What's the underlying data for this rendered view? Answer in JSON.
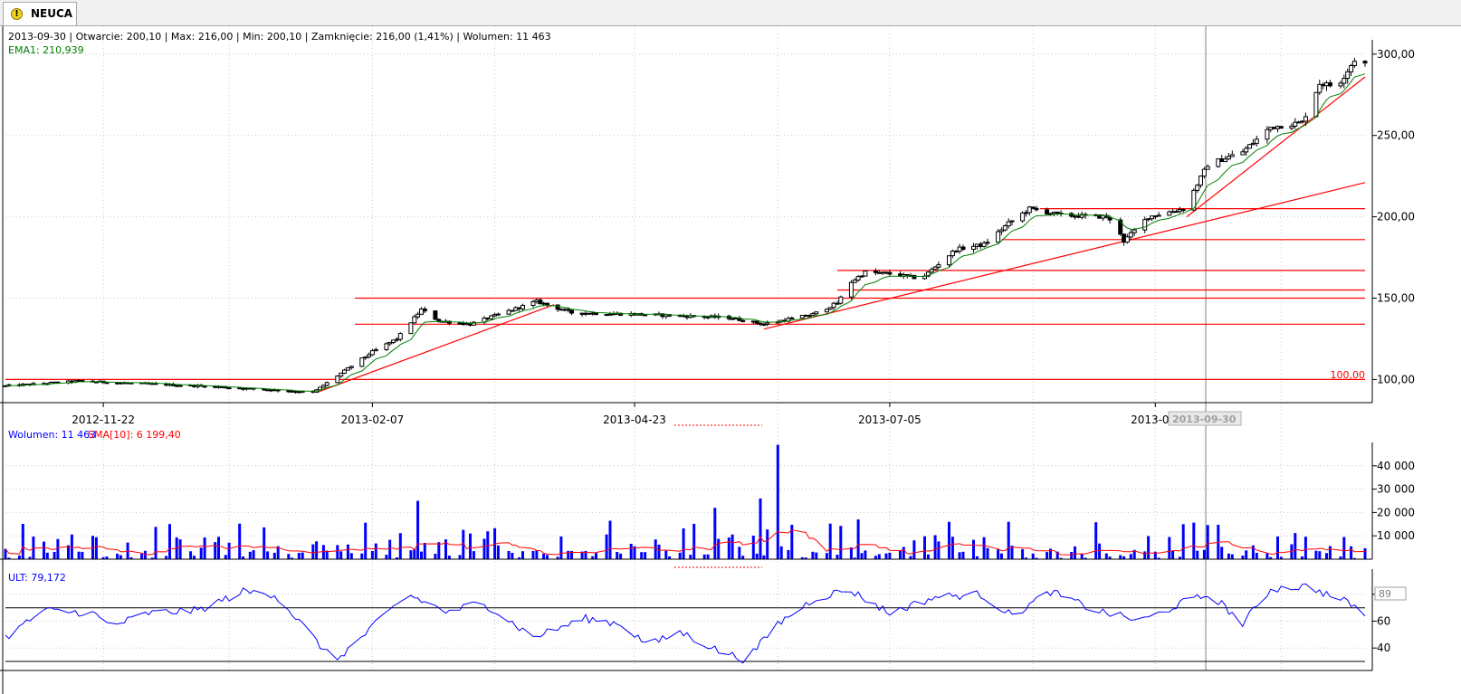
{
  "tab": {
    "label": "NEUCA",
    "icon": "warning-icon"
  },
  "colors": {
    "candle": "#000000",
    "ema": "#008000",
    "trend": "#ff0000",
    "volume": "#0000ff",
    "sma": "#ff0000",
    "ult": "#0000ff",
    "grid": "#c8c8c8"
  },
  "price_info": {
    "date": "2013-09-30",
    "open_label": "Otwarcie:",
    "open": "200,10",
    "max_label": "Max:",
    "max": "216,00",
    "min_label": "Min:",
    "min": "200,10",
    "close_label": "Zamknięcie:",
    "close": "216,00 (1,41%)",
    "volume_label": "Wolumen:",
    "volume": "11 463"
  },
  "ema_label": "EMA1: 210,939",
  "level_label": "100,00",
  "volume_panel": {
    "vol_label": "Wolumen: 11 463",
    "sma_label": "SMA[10]: 6 199,40"
  },
  "ult_panel": {
    "label": "ULT: 79,172",
    "current_value": "89"
  },
  "cursor_date_label": "2013-09-30",
  "chart_data": {
    "type": "candlestick",
    "x_tick_labels": [
      "2012-11-22",
      "2013-02-07",
      "2013-04-23",
      "2013-07-05",
      "2013-09-"
    ],
    "x_tick_dates": [
      "2012-11-22",
      "2013-02-07",
      "2013-04-23",
      "2013-07-05",
      "2013-09-19"
    ],
    "x_range": [
      "2012-10-25",
      "2013-11-18"
    ],
    "price_axis": {
      "ylim": [
        88,
        306
      ],
      "ticks": [
        "100,00",
        "150,00",
        "200,00",
        "250,00",
        "300,00"
      ],
      "tick_values": [
        100,
        150,
        200,
        250,
        300
      ]
    },
    "price_path": [
      {
        "date": "2012-10-25",
        "value": 96
      },
      {
        "date": "2012-11-15",
        "value": 99
      },
      {
        "date": "2012-12-20",
        "value": 96
      },
      {
        "date": "2013-01-14",
        "value": 93
      },
      {
        "date": "2013-01-21",
        "value": 92
      },
      {
        "date": "2013-02-07",
        "value": 117
      },
      {
        "date": "2013-02-14",
        "value": 125
      },
      {
        "date": "2013-02-21",
        "value": 143
      },
      {
        "date": "2013-02-26",
        "value": 136
      },
      {
        "date": "2013-03-07",
        "value": 134
      },
      {
        "date": "2013-03-26",
        "value": 148
      },
      {
        "date": "2013-04-05",
        "value": 141
      },
      {
        "date": "2013-04-25",
        "value": 140
      },
      {
        "date": "2013-05-20",
        "value": 138
      },
      {
        "date": "2013-05-30",
        "value": 134
      },
      {
        "date": "2013-06-13",
        "value": 140
      },
      {
        "date": "2013-06-20",
        "value": 147
      },
      {
        "date": "2013-06-24",
        "value": 160
      },
      {
        "date": "2013-06-28",
        "value": 166
      },
      {
        "date": "2013-07-05",
        "value": 165
      },
      {
        "date": "2013-07-14",
        "value": 162
      },
      {
        "date": "2013-07-24",
        "value": 180
      },
      {
        "date": "2013-08-01",
        "value": 183
      },
      {
        "date": "2013-08-08",
        "value": 196
      },
      {
        "date": "2013-08-14",
        "value": 205
      },
      {
        "date": "2013-08-23",
        "value": 201
      },
      {
        "date": "2013-09-05",
        "value": 200
      },
      {
        "date": "2013-09-09",
        "value": 190
      },
      {
        "date": "2013-09-10",
        "value": 185
      },
      {
        "date": "2013-09-17",
        "value": 200
      },
      {
        "date": "2013-09-27",
        "value": 205
      },
      {
        "date": "2013-09-30",
        "value": 216
      },
      {
        "date": "2013-10-04",
        "value": 232
      },
      {
        "date": "2013-10-14",
        "value": 240
      },
      {
        "date": "2013-10-22",
        "value": 255
      },
      {
        "date": "2013-10-31",
        "value": 258
      },
      {
        "date": "2013-11-05",
        "value": 282
      },
      {
        "date": "2013-11-10",
        "value": 280
      },
      {
        "date": "2013-11-16",
        "value": 300
      },
      {
        "date": "2013-11-18",
        "value": 294
      }
    ],
    "horizontal_levels": [
      {
        "y": 100,
        "from": "2012-10-25",
        "to": "2013-11-18"
      },
      {
        "y": 150,
        "from": "2013-02-02",
        "to": "2013-11-18"
      },
      {
        "y": 134,
        "from": "2013-02-02",
        "to": "2013-11-18"
      },
      {
        "y": 167,
        "from": "2013-06-20",
        "to": "2013-11-18"
      },
      {
        "y": 155,
        "from": "2013-06-20",
        "to": "2013-11-18"
      },
      {
        "y": 186,
        "from": "2013-08-06",
        "to": "2013-11-18"
      },
      {
        "y": 205,
        "from": "2013-08-17",
        "to": "2013-11-18"
      }
    ],
    "trend_lines": [
      {
        "from": {
          "date": "2013-01-22",
          "value": 92
        },
        "to": {
          "date": "2013-03-31",
          "value": 146
        }
      },
      {
        "from": {
          "date": "2013-05-30",
          "value": 131
        },
        "to": {
          "date": "2013-11-18",
          "value": 221
        }
      },
      {
        "from": {
          "date": "2013-09-28",
          "value": 200
        },
        "to": {
          "date": "2013-11-18",
          "value": 286
        }
      }
    ],
    "volume": {
      "ylim": [
        0,
        50000
      ],
      "ticks": [
        "10 000",
        "20 000",
        "30 000",
        "40 000"
      ],
      "tick_values": [
        10000,
        20000,
        30000,
        40000
      ],
      "spikes": [
        {
          "date": "2012-11-19",
          "value": 10000
        },
        {
          "date": "2012-12-08",
          "value": 27000
        },
        {
          "date": "2013-01-27",
          "value": 21000
        },
        {
          "date": "2013-02-02",
          "value": 26500
        },
        {
          "date": "2013-02-20",
          "value": 25000
        },
        {
          "date": "2013-03-03",
          "value": 30000
        },
        {
          "date": "2013-04-13",
          "value": 16000
        },
        {
          "date": "2013-05-16",
          "value": 22000
        },
        {
          "date": "2013-05-29",
          "value": 26000
        },
        {
          "date": "2013-06-03",
          "value": 49000
        },
        {
          "date": "2013-06-26",
          "value": 17000
        },
        {
          "date": "2013-07-22",
          "value": 16000
        },
        {
          "date": "2013-08-08",
          "value": 16000
        },
        {
          "date": "2013-09-27",
          "value": 15000
        },
        {
          "date": "2013-11-16",
          "value": 24000
        }
      ]
    },
    "ult": {
      "ylim": [
        28,
        92
      ],
      "ticks": [
        "40",
        "60",
        "80"
      ],
      "tick_values": [
        40,
        60,
        80
      ],
      "levels": [
        70,
        30
      ],
      "points": [
        {
          "date": "2012-10-25",
          "value": 48
        },
        {
          "date": "2012-11-05",
          "value": 68
        },
        {
          "date": "2012-11-19",
          "value": 66
        },
        {
          "date": "2012-11-24",
          "value": 56
        },
        {
          "date": "2012-12-05",
          "value": 66
        },
        {
          "date": "2012-12-19",
          "value": 68
        },
        {
          "date": "2013-01-01",
          "value": 82
        },
        {
          "date": "2013-01-10",
          "value": 80
        },
        {
          "date": "2013-01-17",
          "value": 60
        },
        {
          "date": "2013-01-27",
          "value": 30
        },
        {
          "date": "2013-02-04",
          "value": 48
        },
        {
          "date": "2013-02-17",
          "value": 80
        },
        {
          "date": "2013-03-01",
          "value": 66
        },
        {
          "date": "2013-03-10",
          "value": 75
        },
        {
          "date": "2013-03-25",
          "value": 48
        },
        {
          "date": "2013-04-09",
          "value": 62
        },
        {
          "date": "2013-04-19",
          "value": 58
        },
        {
          "date": "2013-04-27",
          "value": 42
        },
        {
          "date": "2013-05-06",
          "value": 52
        },
        {
          "date": "2013-05-17",
          "value": 38
        },
        {
          "date": "2013-05-25",
          "value": 31
        },
        {
          "date": "2013-06-03",
          "value": 58
        },
        {
          "date": "2013-06-13",
          "value": 76
        },
        {
          "date": "2013-06-23",
          "value": 84
        },
        {
          "date": "2013-07-05",
          "value": 66
        },
        {
          "date": "2013-07-18",
          "value": 78
        },
        {
          "date": "2013-07-31",
          "value": 80
        },
        {
          "date": "2013-08-09",
          "value": 64
        },
        {
          "date": "2013-08-20",
          "value": 82
        },
        {
          "date": "2013-09-02",
          "value": 68
        },
        {
          "date": "2013-09-15",
          "value": 60
        },
        {
          "date": "2013-09-27",
          "value": 74
        },
        {
          "date": "2013-10-05",
          "value": 80
        },
        {
          "date": "2013-10-14",
          "value": 58
        },
        {
          "date": "2013-10-22",
          "value": 84
        },
        {
          "date": "2013-11-02",
          "value": 86
        },
        {
          "date": "2013-11-07",
          "value": 80
        },
        {
          "date": "2013-11-14",
          "value": 73
        },
        {
          "date": "2013-11-18",
          "value": 64
        }
      ]
    }
  }
}
